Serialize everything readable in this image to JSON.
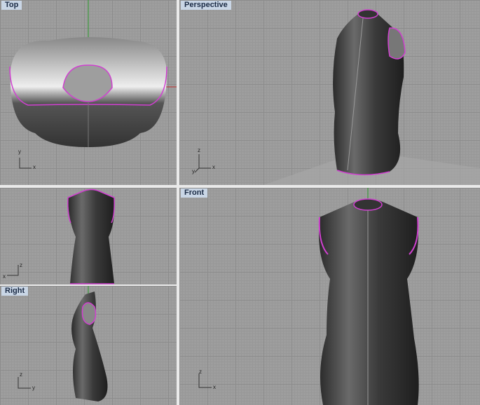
{
  "viewports": {
    "top": {
      "label": "Top",
      "axes": [
        "y",
        "x"
      ]
    },
    "perspective": {
      "label": "Perspective",
      "axes": [
        "z",
        "y",
        "x"
      ]
    },
    "back": {
      "axes": [
        "z",
        "x"
      ]
    },
    "right": {
      "label": "Right",
      "axes": [
        "z",
        "y"
      ]
    },
    "front": {
      "label": "Front",
      "axes": [
        "z",
        "x"
      ]
    }
  },
  "colors": {
    "selection": "#d040d0",
    "grid": "#9e9e9e",
    "y_axis": "#2a9a2a",
    "x_axis": "#c03030"
  }
}
